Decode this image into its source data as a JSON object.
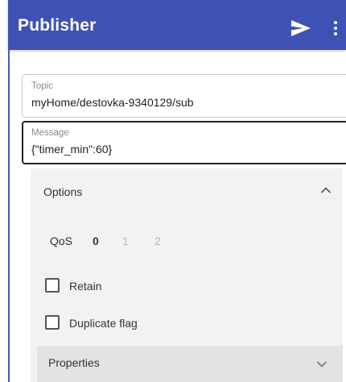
{
  "appbar": {
    "title": "Publisher",
    "send_icon": "send-icon",
    "more_icon": "more-vert-icon",
    "color": "#3f51b5"
  },
  "topic": {
    "label": "Topic",
    "value": "myHome/destovka-9340129/sub"
  },
  "message": {
    "label": "Message",
    "value": "{\"timer_min\":60}"
  },
  "options": {
    "title": "Options",
    "expanded": true,
    "qos": {
      "label": "QoS",
      "values": [
        "0",
        "1",
        "2"
      ],
      "selected": "0"
    },
    "retain": {
      "label": "Retain",
      "checked": false
    },
    "duplicate": {
      "label": "Duplicate flag",
      "checked": false
    },
    "properties": {
      "title": "Properties",
      "expanded": false
    }
  }
}
